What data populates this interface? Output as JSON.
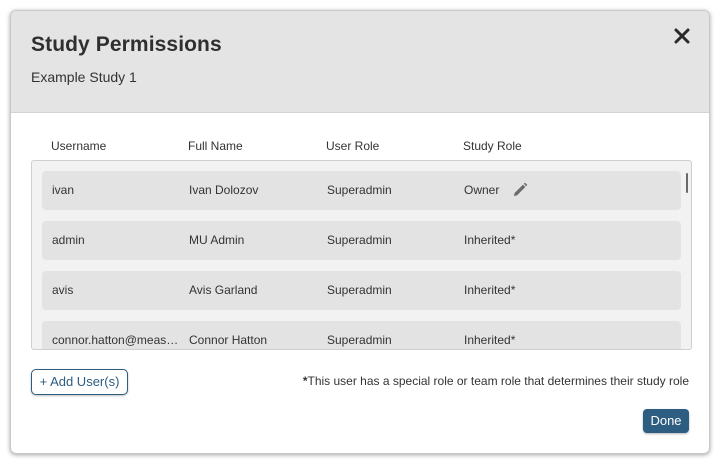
{
  "modal": {
    "title": "Study Permissions",
    "subtitle": "Example Study 1",
    "close_icon": "close-icon"
  },
  "table": {
    "headers": [
      "Username",
      "Full Name",
      "User Role",
      "Study Role"
    ],
    "rows": [
      {
        "username": "ivan",
        "full_name": "Ivan Dolozov",
        "user_role": "Superadmin",
        "study_role": "Owner",
        "editable": true
      },
      {
        "username": "admin",
        "full_name": "MU Admin",
        "user_role": "Superadmin",
        "study_role": "Inherited*",
        "editable": false
      },
      {
        "username": "avis",
        "full_name": "Avis Garland",
        "user_role": "Superadmin",
        "study_role": "Inherited*",
        "editable": false
      },
      {
        "username": "connor.hatton@meas…",
        "full_name": "Connor Hatton",
        "user_role": "Superadmin",
        "study_role": "Inherited*",
        "editable": false
      }
    ]
  },
  "footer": {
    "add_user_label": "+ Add User(s)",
    "footnote_asterisk": "*",
    "footnote_text": "This user has a special role or team role that determines their study role",
    "done_label": "Done"
  },
  "colors": {
    "accent": "#2d5e82",
    "header_bg": "#e4e4e4",
    "row_bg": "#e3e3e3"
  }
}
